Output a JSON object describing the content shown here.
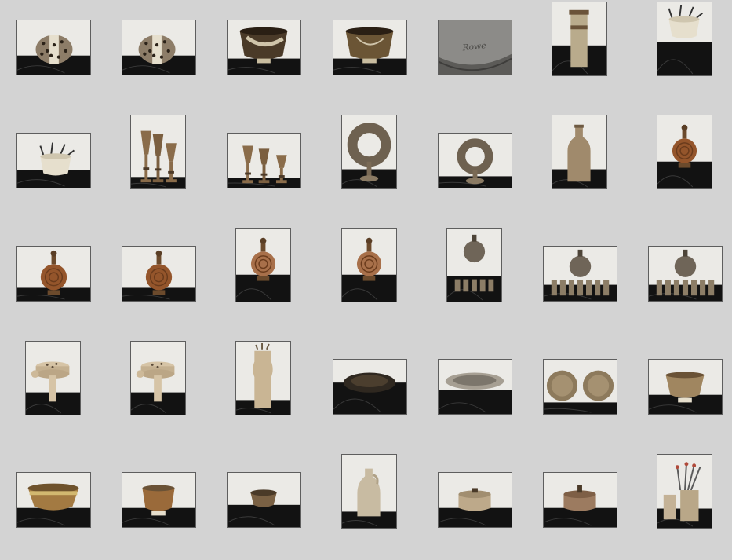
{
  "gallery": {
    "thumbnails": [
      {
        "subject": "pierced-sphere",
        "variant": 0
      },
      {
        "subject": "pierced-sphere",
        "variant": 1
      },
      {
        "subject": "glazed-bowl",
        "variant": 0
      },
      {
        "subject": "glazed-bowl",
        "variant": 1
      },
      {
        "subject": "signature-closeup",
        "text": "Rowe"
      },
      {
        "subject": "tall-cylinder-vase",
        "variant": 0
      },
      {
        "subject": "bowl-with-utensils",
        "variant": 0
      },
      {
        "subject": "bowl-with-utensils",
        "variant": 1
      },
      {
        "subject": "goblet-trio",
        "variant": 0
      },
      {
        "subject": "goblet-trio",
        "variant": 1
      },
      {
        "subject": "ring-sculpture",
        "variant": 0
      },
      {
        "subject": "ring-sculpture",
        "variant": 1
      },
      {
        "subject": "bottle-vase",
        "variant": 0
      },
      {
        "subject": "round-flask",
        "variant": 0
      },
      {
        "subject": "round-flask",
        "variant": 1
      },
      {
        "subject": "round-flask",
        "variant": 2
      },
      {
        "subject": "round-flask",
        "variant": 3
      },
      {
        "subject": "round-flask",
        "variant": 4
      },
      {
        "subject": "flask-with-cups",
        "variant": 0
      },
      {
        "subject": "flask-with-cups",
        "variant": 1
      },
      {
        "subject": "flask-with-cups",
        "variant": 2
      },
      {
        "subject": "pierced-stand",
        "variant": 0
      },
      {
        "subject": "pierced-stand",
        "variant": 1
      },
      {
        "subject": "tall-utensil-holder",
        "variant": 0
      },
      {
        "subject": "dark-plate",
        "variant": 0
      },
      {
        "subject": "shallow-dish",
        "variant": 0
      },
      {
        "subject": "plate-pair",
        "variant": 0
      },
      {
        "subject": "footed-bowl",
        "variant": 0
      },
      {
        "subject": "wide-bowl",
        "variant": 0
      },
      {
        "subject": "footed-bowl",
        "variant": 1
      },
      {
        "subject": "low-bowl",
        "variant": 0
      },
      {
        "subject": "jug",
        "variant": 0
      },
      {
        "subject": "lidded-pot",
        "variant": 0
      },
      {
        "subject": "lidded-pot",
        "variant": 1
      },
      {
        "subject": "utensil-jars",
        "variant": 0
      }
    ]
  },
  "colors": {
    "page_background": "#d3d3d3",
    "thumb_border": "#5e5e5e",
    "backdrop": "#ebeae6",
    "surface": "#121212",
    "stoneware": "#b9ab8c",
    "brown_glaze": "#7a5230",
    "rust_glaze": "#94552b",
    "cream": "#e6dfcd"
  }
}
